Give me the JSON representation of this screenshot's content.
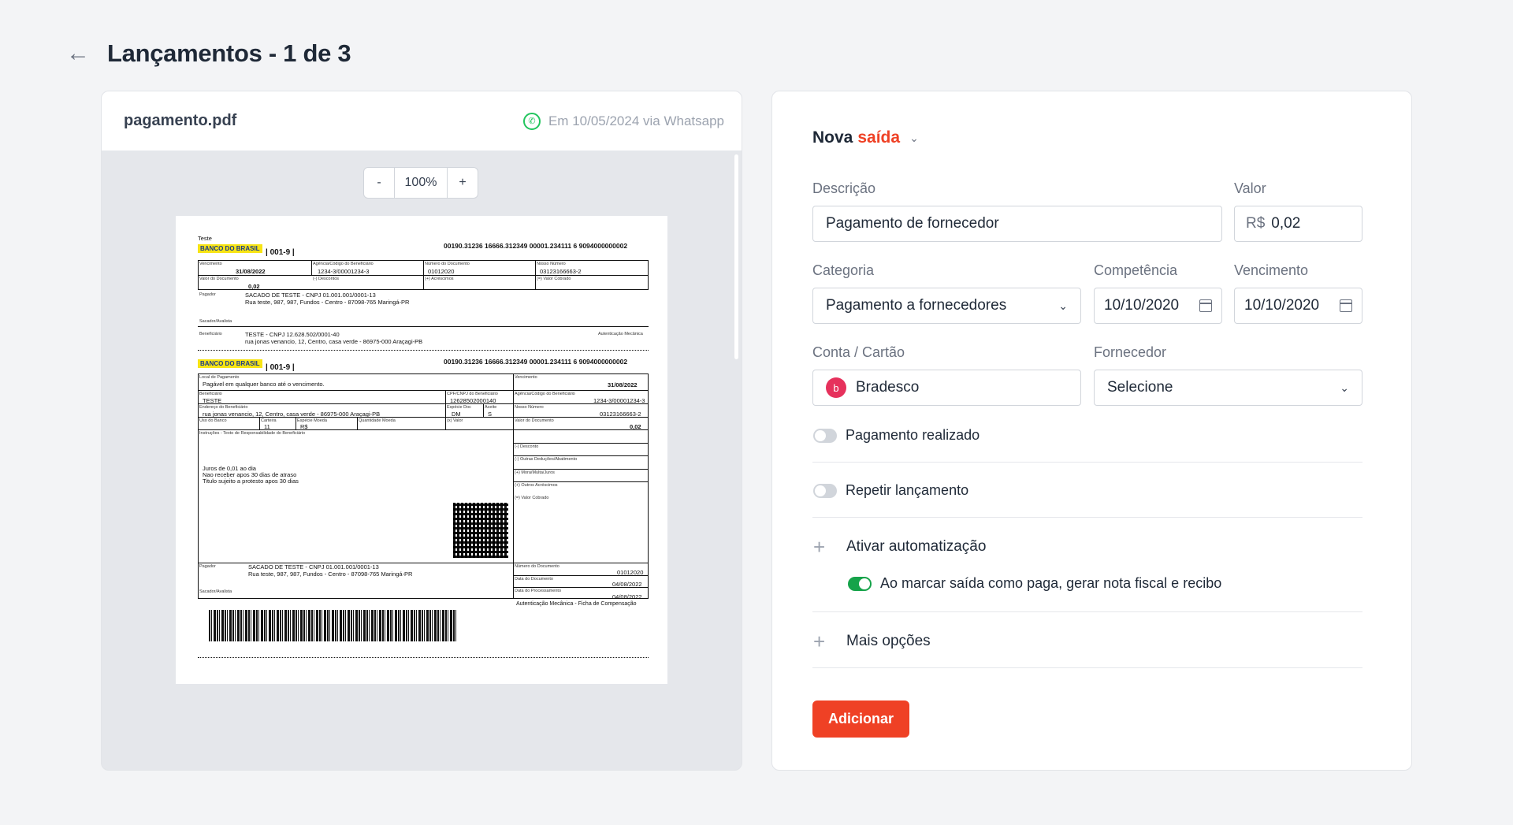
{
  "header": {
    "title": "Lançamentos - 1 de 3",
    "back_icon": "arrow-left-icon"
  },
  "viewer": {
    "filename": "pagamento.pdf",
    "received": "Em 10/05/2024 via Whatsapp",
    "zoom": {
      "minus": "-",
      "value": "100%",
      "plus": "+"
    }
  },
  "doc": {
    "teste": "Teste",
    "bank_logo": "BANCO DO BRASIL",
    "bank_code": "| 001-9 |",
    "linha_digitavel": "00190.31236 16666.312349 00001.234111 6 9094000000002",
    "vencimento_label": "Vencimento",
    "vencimento": "31/08/2022",
    "agencia_label": "Agência/Código do Beneficiário",
    "agencia": "1234-3/00001234-3",
    "numdoc_label": "Número do Documento",
    "numdoc": "01012020",
    "nossonum_label": "Nosso Número",
    "nossonum": "03123166663-2",
    "valor_label": "Valor do Documento",
    "valor": "0,02",
    "descontos_label": "(-) Descontos",
    "acrescimos_label": "(+) Acréscimos",
    "valor_cobrado_label": "(=) Valor Cobrado",
    "pagador_label": "Pagador",
    "pagador": "SACADO DE TESTE - CNPJ 01.001.001/0001-13",
    "pagador_end": "Rua teste, 987, 987, Fundos - Centro - 87098-765 Maringá-PR",
    "sacador_label": "Sacador/Avalista",
    "beneficiario_label": "Beneficiário",
    "beneficiario": "TESTE - CNPJ 12.628.502/0001-40",
    "beneficiario_end": "rua jonas venancio, 12, Centro, casa verde - 86975-000 Araçagi-PB",
    "autenticacao": "Autenticação Mecânica",
    "local_label": "Local de Pagamento",
    "local": "Pagável em qualquer banco até o vencimento.",
    "benef_short": "TESTE",
    "cpf_label": "CPF/CNPJ do Beneficiário",
    "cpf": "12628502000140",
    "endereco_label": "Endereço do Beneficiário",
    "endereco": "rua jonas venancio, 12, Centro, casa verde - 86975-000 Araçagi-PB",
    "especie_doc_label": "Espécie Doc",
    "especie_doc": "DM",
    "aceite_label": "Aceite",
    "aceite": "S",
    "uso_label": "Uso do Banco",
    "carteira_label": "Carteira",
    "carteira": "11",
    "especie_moeda_label": "Espécie Moeda",
    "especie_moeda": "R$",
    "quantidade_label": "Quantidade Moeda",
    "xvalor_label": "(x) Valor",
    "instrucoes_label": "Instruções - Texto de Responsabilidade do Beneficiário",
    "desconto_label": "(-) Desconto",
    "outras_deducoes_label": "(-) Outras Deduções/Abatimento",
    "mora_label": "(+) Mora/Multa/Juros",
    "outros_acrescimos_label": "(+) Outros Acréscimos",
    "instr1": "Juros de 0,01 ao dia",
    "instr2": "Nao receber apos 30 dias de atraso",
    "instr3": "Titulo sujeito a protesto apos 30 dias",
    "data_doc_label": "Data do Documento",
    "data_doc": "04/08/2022",
    "data_proc_label": "Data do Processamento",
    "data_proc": "04/08/2022",
    "ficha": "Autenticação Mecânica - Ficha de Compensação"
  },
  "form": {
    "mode_prefix": "Nova",
    "mode_accent": "saída",
    "accent_color": "#ef4125",
    "descricao_label": "Descrição",
    "descricao_value": "Pagamento de fornecedor",
    "valor_label": "Valor",
    "valor_prefix": "R$",
    "valor_value": "0,02",
    "categoria_label": "Categoria",
    "categoria_value": "Pagamento a fornecedores",
    "competencia_label": "Competência",
    "competencia_value": "10/10/2020",
    "vencimento_label": "Vencimento",
    "vencimento_value": "10/10/2020",
    "conta_label": "Conta / Cartão",
    "conta_value": "Bradesco",
    "fornecedor_label": "Fornecedor",
    "fornecedor_value": "Selecione",
    "pagamento_realizado": "Pagamento realizado",
    "repetir": "Repetir lançamento",
    "automatizacao": "Ativar automatização",
    "automatizacao_opcao": "Ao marcar saída como paga, gerar nota fiscal e recibo",
    "mais_opcoes": "Mais opções",
    "submit": "Adicionar"
  }
}
